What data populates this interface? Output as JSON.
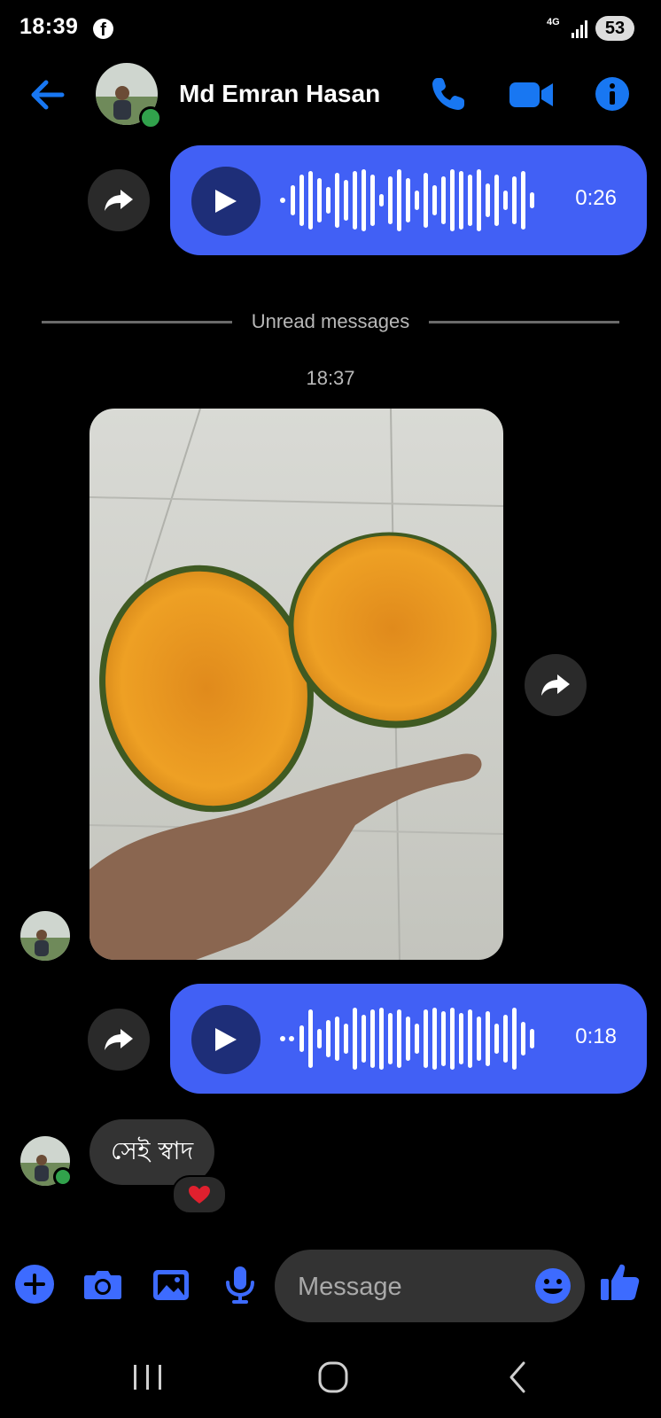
{
  "status_bar": {
    "time": "18:39",
    "network": "4G",
    "battery": "53",
    "icons": [
      "facebook-icon",
      "signal-icon"
    ]
  },
  "header": {
    "contact_name": "Md Emran Hasan",
    "icons": [
      "back-arrow-icon",
      "phone-icon",
      "video-camera-icon",
      "info-icon"
    ],
    "online": true
  },
  "messages": [
    {
      "type": "voice",
      "duration": "0:26",
      "outgoing": true
    },
    {
      "type": "divider",
      "label": "Unread messages"
    },
    {
      "type": "timestamp",
      "label": "18:37"
    },
    {
      "type": "image",
      "description_icon": "photo",
      "outgoing": false
    },
    {
      "type": "voice",
      "duration": "0:18",
      "outgoing": true
    },
    {
      "type": "text",
      "text": "সেই স্বাদ",
      "reaction": "heart",
      "outgoing": false
    }
  ],
  "composer": {
    "placeholder": "Message",
    "icons": [
      "plus-icon",
      "camera-icon",
      "gallery-icon",
      "mic-icon",
      "emoji-icon",
      "thumbs-up-icon"
    ]
  },
  "colors": {
    "accent": "#1877f2",
    "bubble_outgoing": "#4160f5",
    "bubble_incoming": "#333333",
    "online": "#31a24c",
    "background": "#000000"
  }
}
